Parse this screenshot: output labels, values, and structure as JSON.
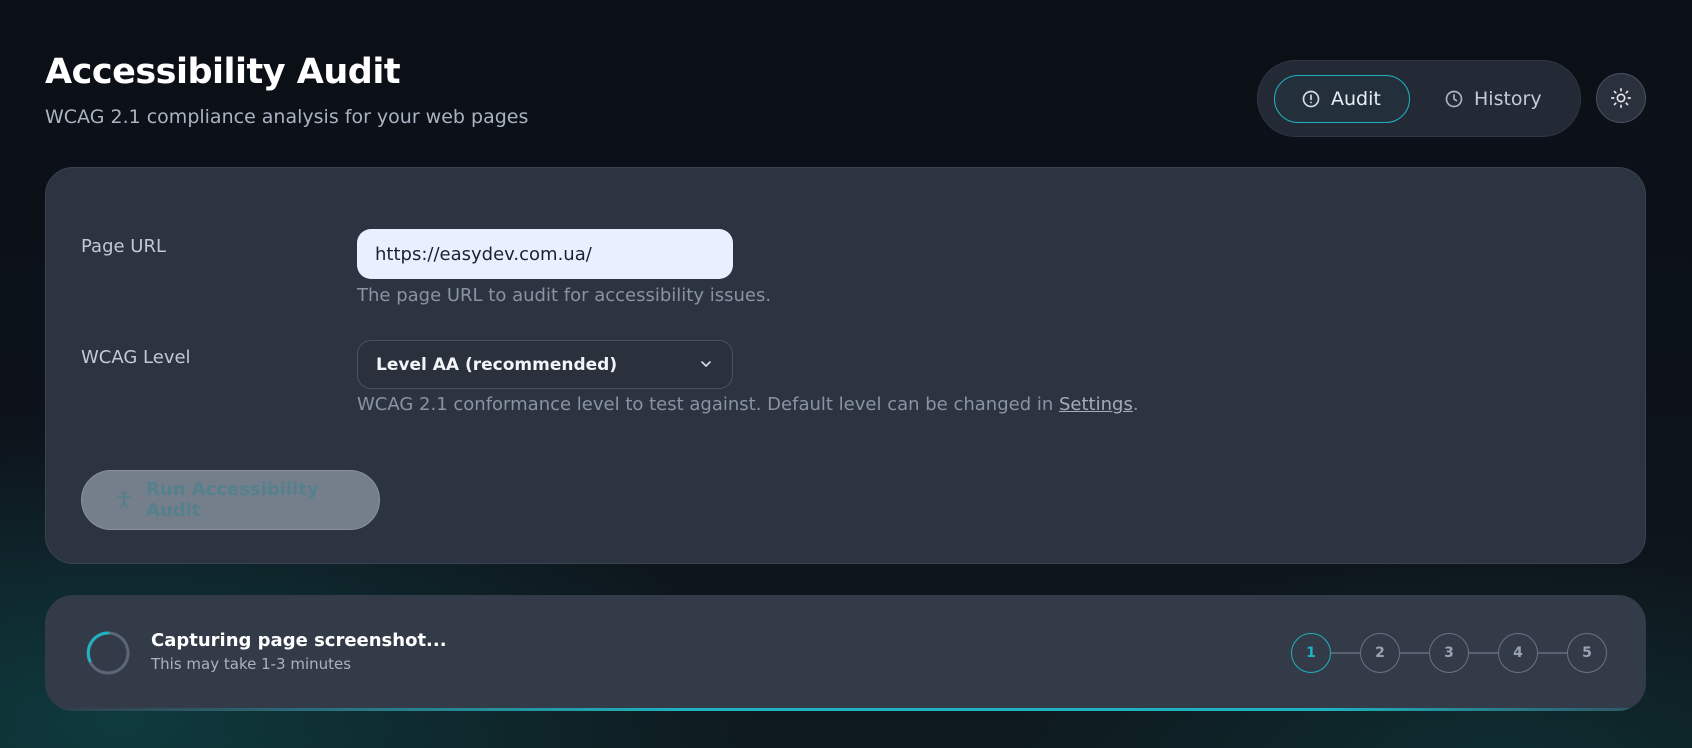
{
  "header": {
    "title": "Accessibility Audit",
    "subtitle": "WCAG 2.1 compliance analysis for your web pages"
  },
  "nav": {
    "tabs": [
      {
        "label": "Audit",
        "icon": "alert-circle-icon",
        "active": true
      },
      {
        "label": "History",
        "icon": "clock-icon",
        "active": false
      }
    ],
    "theme_toggle_icon": "sun-icon"
  },
  "form": {
    "url_label": "Page URL",
    "url_value": "https://easydev.com.ua/",
    "url_help": "The page URL to audit for accessibility issues.",
    "level_label": "WCAG Level",
    "level_selected": "Level AA (recommended)",
    "level_help_prefix": "WCAG 2.1 conformance level to test against. Default level can be changed in ",
    "level_help_link": "Settings",
    "level_help_suffix": ".",
    "run_label": "Run Accessibility Audit",
    "run_icon": "accessibility-person-icon"
  },
  "progress": {
    "status": "Capturing page screenshot...",
    "substatus": "This may take 1-3 minutes",
    "steps": [
      "1",
      "2",
      "3",
      "4",
      "5"
    ],
    "current_step": 1
  },
  "colors": {
    "accent": "#1fb3c0",
    "card": "#2d3441",
    "background": "#0b0f16"
  }
}
